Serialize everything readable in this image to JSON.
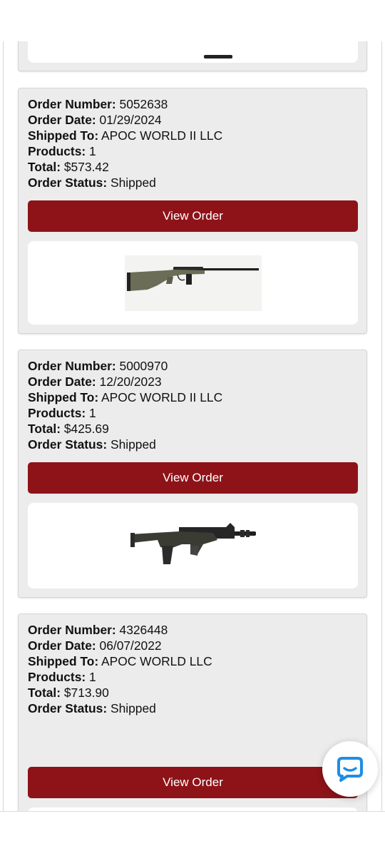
{
  "labels": {
    "order_number": "Order Number:",
    "order_date": "Order Date:",
    "shipped_to": "Shipped To:",
    "products": "Products:",
    "total": "Total:",
    "order_status": "Order Status:"
  },
  "view_order_label": "View Order",
  "orders": [
    {
      "number": "5052638",
      "date": "01/29/2024",
      "shipped_to": "APOC WORLD II LLC",
      "products": "1",
      "total": "$573.42",
      "status": "Shipped",
      "image_icon": "bolt-action-rifle-green-stock"
    },
    {
      "number": "5000970",
      "date": "12/20/2023",
      "shipped_to": "APOC WORLD II LLC",
      "products": "1",
      "total": "$425.69",
      "status": "Shipped",
      "image_icon": "bullpup-shotgun"
    },
    {
      "number": "4326448",
      "date": "06/07/2022",
      "shipped_to": "APOC WORLD LLC",
      "products": "1",
      "total": "$713.90",
      "status": "Shipped",
      "image_icon": "bolt-action-rifle-with-scope"
    }
  ],
  "colors": {
    "button": "#8d1318",
    "card_bg": "#ececec",
    "chat_icon": "#1c8ee6"
  },
  "chat_button": {
    "icon": "chat-bubble-icon"
  }
}
